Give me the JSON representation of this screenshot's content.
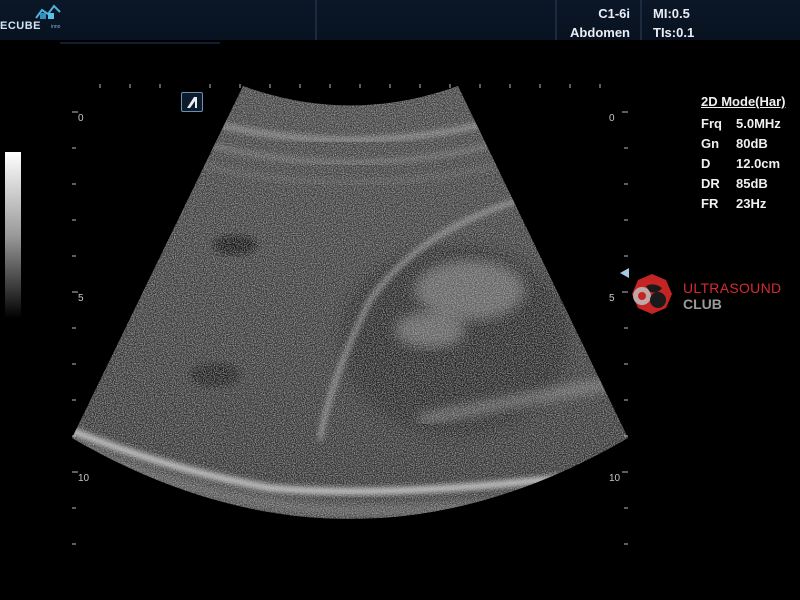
{
  "header": {
    "logo_text": "ECUBE",
    "logo_sub": "inno",
    "probe": "C1-6i",
    "exam": "Abdomen",
    "mi": "MI:0.5",
    "tis": "TIs:0.1"
  },
  "depth_scale": {
    "left": [
      "0",
      "5",
      "10"
    ],
    "right": [
      "0",
      "5",
      "10"
    ]
  },
  "params": {
    "mode": "2D Mode(Har)",
    "rows": [
      {
        "k": "Frq",
        "v": "5.0MHz"
      },
      {
        "k": "Gn",
        "v": "80dB"
      },
      {
        "k": "D",
        "v": "12.0cm"
      },
      {
        "k": "DR",
        "v": "85dB"
      },
      {
        "k": "FR",
        "v": "23Hz"
      }
    ]
  },
  "watermark": {
    "line1": "ULTRASOUND",
    "line2": "CLUB",
    "color_primary": "#d62b2b",
    "color_secondary": "#9a9a9a"
  },
  "icons": {
    "orientation_marker": "orientation-marker-icon",
    "focus_marker": "focus-marker-icon"
  }
}
